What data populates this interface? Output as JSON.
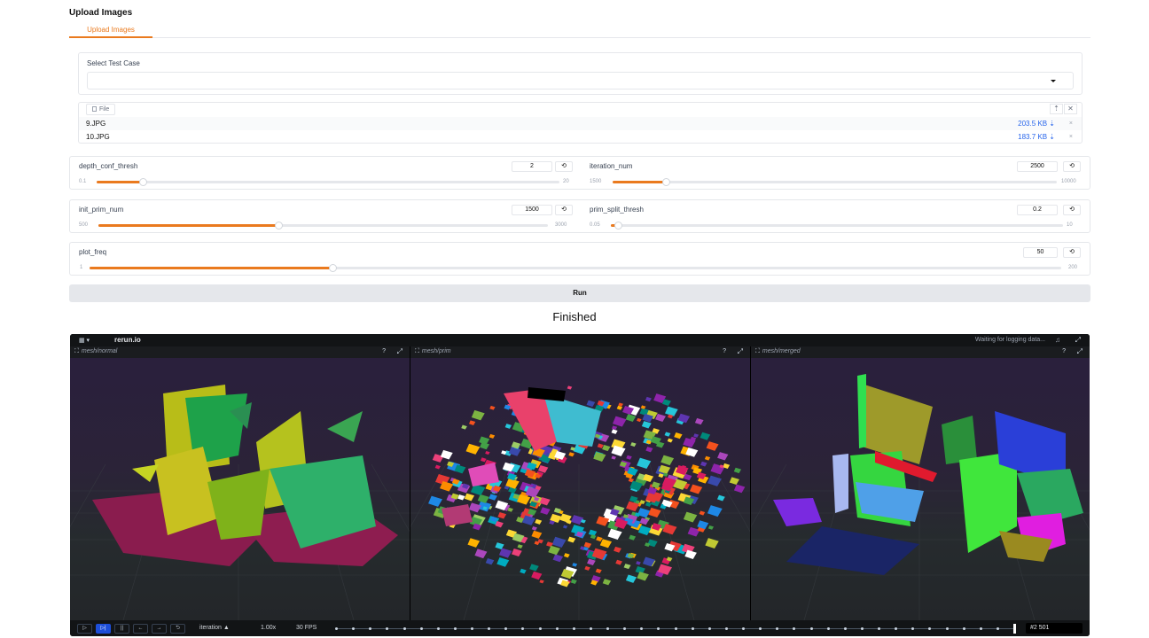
{
  "page": {
    "title": "Upload Images",
    "tab": "Upload Images"
  },
  "test_case": {
    "label": "Select Test Case",
    "value": ""
  },
  "file_upload": {
    "chip": "File",
    "files": [
      {
        "name": "9.JPG",
        "size": "203.5 KB ⇣",
        "remove": "×"
      },
      {
        "name": "10.JPG",
        "size": "183.7 KB ⇣",
        "remove": "×"
      }
    ]
  },
  "sliders": {
    "depth_conf_thresh": {
      "label": "depth_conf_thresh",
      "value": "2",
      "min": "0.1",
      "max": "20",
      "fraction": 0.1
    },
    "iteration_num": {
      "label": "iteration_num",
      "value": "2500",
      "min": "1500",
      "max": "10000",
      "fraction": 0.12
    },
    "init_prim_num": {
      "label": "init_prim_num",
      "value": "1500",
      "min": "500",
      "max": "3000",
      "fraction": 0.4
    },
    "prim_split_thresh": {
      "label": "prim_split_thresh",
      "value": "0.2",
      "min": "0.05",
      "max": "10",
      "fraction": 0.015
    },
    "plot_freq": {
      "label": "plot_freq",
      "value": "50",
      "min": "1",
      "max": "200",
      "fraction": 0.25
    }
  },
  "reset_icon": "⟲",
  "run_label": "Run",
  "status": "Finished",
  "viewer": {
    "brand": "rerun.io",
    "waiting": "Waiting for logging data...",
    "panels": [
      {
        "title": "mesh/normal",
        "help": "?"
      },
      {
        "title": "mesh/prim",
        "help": "?"
      },
      {
        "title": "mesh/merged",
        "help": "?"
      }
    ],
    "timeline": {
      "timeline_name": "iteration ▲",
      "speed": "1.00x",
      "fps": "30 FPS",
      "frame": "#2 501"
    }
  },
  "icons": [
    "menu-icon",
    "bell-icon",
    "maximize-icon",
    "upload-icon",
    "clear-icon",
    "play-icon",
    "pause-icon",
    "step-back-icon",
    "step-forward-icon",
    "loop-icon",
    "space-view-icon"
  ]
}
